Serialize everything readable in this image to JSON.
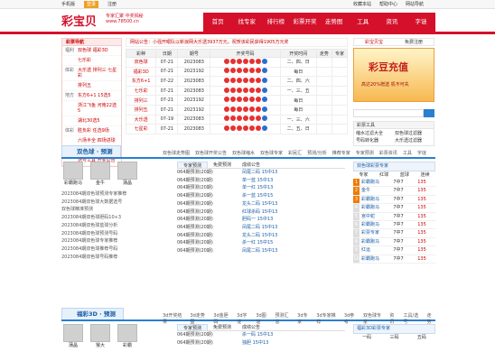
{
  "topbar": {
    "items": [
      "手机版",
      "登录",
      "注册"
    ],
    "right": [
      "收藏本站",
      "帮助中心",
      "网站导航"
    ]
  },
  "header": {
    "logo": "彩宝贝",
    "slogan1": "专家汇聚 中奖揭秘",
    "slogan2": "www.78500.cn",
    "nav": [
      "首页",
      "找专家",
      "排行榜",
      "彩票开奖",
      "走势图",
      "工具",
      "资讯",
      "字谜"
    ]
  },
  "left_nav": {
    "title": "彩票导航",
    "rows": [
      {
        "cat": "福利",
        "links": "双色球 福彩3D"
      },
      {
        "cat": "",
        "links": "七乐彩"
      },
      {
        "cat": "体彩",
        "links": "大乐透 排列三 七星彩"
      },
      {
        "cat": "",
        "links": "排列五"
      },
      {
        "cat": "地方",
        "links": "东方6+1 15选5"
      },
      {
        "cat": "",
        "links": "浙江飞鱼 河南22选5"
      },
      {
        "cat": "",
        "links": "湖北30选5"
      },
      {
        "cat": "体彩",
        "links": "胜负彩 任选9场"
      },
      {
        "cat": "",
        "links": "六场半全 四场进球"
      },
      {
        "cat": "专家",
        "links": "彩票专家 排行榜"
      },
      {
        "cat": "",
        "links": "选号工具 开奖公告"
      }
    ]
  },
  "notice": "网站公告：小强开眼队以新浪网大乐透3937万元，祝贺该彩民获得1905万元奖",
  "draw_table": {
    "headers": [
      "彩种",
      "日期",
      "期号",
      "开奖号码",
      "开奖时间",
      "走势",
      "专家"
    ],
    "rows": [
      {
        "lot": "双色球",
        "date": "07-21",
        "issue": "2023083",
        "open": "二、四、日"
      },
      {
        "lot": "福彩3D",
        "date": "07-21",
        "issue": "2023192",
        "open": "每日"
      },
      {
        "lot": "东方6+1",
        "date": "07-22",
        "issue": "2023083",
        "open": "二、四、六"
      },
      {
        "lot": "七乐彩",
        "date": "07-21",
        "issue": "2023083",
        "open": "一、三、五"
      },
      {
        "lot": "排列三",
        "date": "07-21",
        "issue": "2023192",
        "open": "每日"
      },
      {
        "lot": "排列五",
        "date": "07-21",
        "issue": "2023192",
        "open": "每日"
      },
      {
        "lot": "大乐透",
        "date": "07-19",
        "issue": "2023083",
        "open": "一、三、六"
      },
      {
        "lot": "七星彩",
        "date": "07-21",
        "issue": "2023083",
        "open": "二、五、日"
      }
    ]
  },
  "right": {
    "tabs": [
      "彩宝贝宝",
      "免费注册"
    ],
    "banner_big": "彩豆充值",
    "banner_sub": "高达20%赠送 机不可失",
    "tools_title": "彩票工具",
    "tools": [
      "缩水过滤大全",
      "双色球过滤器",
      "号码转化器",
      "大乐透过滤器"
    ]
  },
  "ssq": {
    "title": "双色球 · 预测",
    "links": [
      "双色球走势图",
      "双色球开奖公告",
      "双色球缩水",
      "双色球专家",
      "彩民汇",
      "预测/分析",
      "推荐专家",
      "专家预测",
      "彩票资讯",
      "工具",
      "字谜"
    ],
    "experts": [
      "彩霸跑马",
      "金牛",
      "蒲晶"
    ],
    "news": [
      "2023084期双色球预测专家推荐",
      "2023084期双色球大数据选号",
      "双色球精准预测",
      "2023084期双色球胆码10+3",
      "2023084期双色球蓝球分析",
      "2023084期双色球预测号码",
      "2023084期双色球专家推荐",
      "2023084期双色球推荐号码",
      "2023084期双色球号码推荐"
    ],
    "mtabs": [
      "专家预测",
      "免费预测",
      "成绩公告"
    ],
    "recs": [
      {
        "a": "064期预测(20期)",
        "b": "凤尾二码 15中13"
      },
      {
        "a": "064期预测(20期)",
        "b": "单一蓝 15中13"
      },
      {
        "a": "064期预测(20期)",
        "b": "单一红 15中13"
      },
      {
        "a": "064期预测(20期)",
        "b": "杀一蓝 15中15"
      },
      {
        "a": "064期预测(20期)",
        "b": "龙头二码 15中13"
      },
      {
        "a": "064期预测(20期)",
        "b": "红球杀码 15中13"
      },
      {
        "a": "064期预测(20期)",
        "b": "胆码一 15中13"
      },
      {
        "a": "064期预测(20期)",
        "b": "凤尾二码 15中13"
      },
      {
        "a": "064期预测(20期)",
        "b": "龙头二码 15中13"
      },
      {
        "a": "064期预测(20期)",
        "b": "杀一红 15中15"
      },
      {
        "a": "064期预测(20期)",
        "b": "凤尾二码 15中13"
      }
    ],
    "rank": {
      "title": "双色球彩票专家",
      "sub": [
        "专家",
        "红球",
        "蓝球",
        "连续"
      ],
      "rows": [
        {
          "n": "1",
          "name": "彩霸跑马",
          "hit": "7中7",
          "val": "135"
        },
        {
          "n": "2",
          "name": "金牛",
          "hit": "7中7",
          "val": "135"
        },
        {
          "n": "3",
          "name": "彩霸跑马",
          "hit": "7中7",
          "val": "135"
        },
        {
          "n": "4",
          "name": "彩霸跑马",
          "hit": "7中7",
          "val": "135"
        },
        {
          "n": "5",
          "name": "宫中蛇",
          "hit": "7中7",
          "val": "135"
        },
        {
          "n": "6",
          "name": "彩霸跑马",
          "hit": "7中7",
          "val": "135"
        },
        {
          "n": "7",
          "name": "彩票专家",
          "hit": "7中7",
          "val": "135"
        },
        {
          "n": "8",
          "name": "彩霸跑马",
          "hit": "7中7",
          "val": "135"
        },
        {
          "n": "9",
          "name": "红运",
          "hit": "7中7",
          "val": "135"
        },
        {
          "n": "10",
          "name": "彩霸跑马",
          "hit": "7中7",
          "val": "135"
        }
      ]
    }
  },
  "fc3d": {
    "title": "福彩3D · 预测",
    "links": [
      "3d开奖结果",
      "3d走势图",
      "3d金胆码",
      "3d字谜",
      "3d图谜",
      "预测汇总",
      "3d专家",
      "3d专家推荐",
      "3d参考",
      "双色球专家",
      "资讯",
      "工具/选号",
      "走势"
    ],
    "experts": [
      "蒲晶",
      "猴大",
      "彩霸"
    ],
    "mtabs": [
      "专家预测",
      "免费预测",
      "成绩公告"
    ],
    "recs": [
      {
        "a": "064期预测(20期)",
        "b": "杀一码 15中13"
      },
      {
        "a": "064期预测(20期)",
        "b": "独胆 15中13"
      }
    ],
    "rank_title": "福彩3D彩票专家",
    "rank_sub": [
      "一码",
      "三码",
      "五码"
    ]
  }
}
